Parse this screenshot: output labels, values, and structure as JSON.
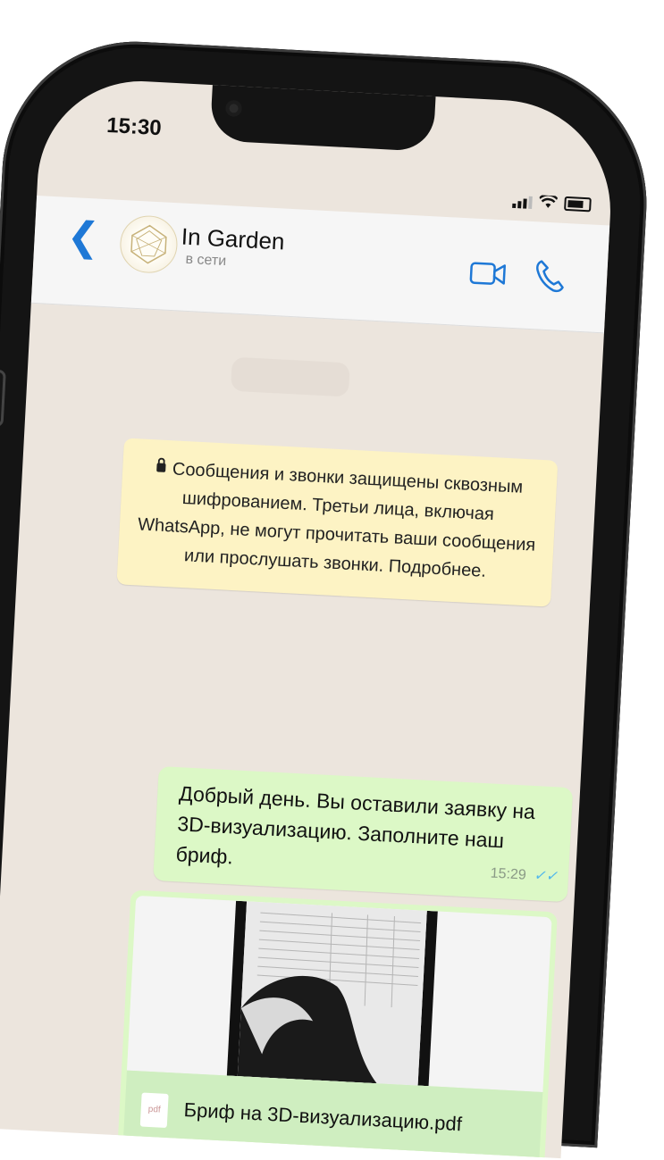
{
  "status_bar": {
    "time": "15:30"
  },
  "header": {
    "contact_name": "In Garden",
    "contact_status": "в сети",
    "back_icon": "chevron-left-icon",
    "video_icon": "video-call-icon",
    "call_icon": "phone-icon",
    "accent_color": "#1e78d6"
  },
  "notice": {
    "text": "Сообщения и звонки защищены сквозным шифрованием. Третьи лица, включая WhatsApp, не могут прочитать ваши сообщения или прослушать звонки. Подробнее."
  },
  "messages": [
    {
      "text": "Добрый день. Вы оставили заявку на 3D-визуализацию. Заполните наш бриф.",
      "time": "15:29",
      "status": "read"
    }
  ],
  "document": {
    "icon_label": "pdf",
    "filename": "Бриф на 3D-визуализацию.pdf"
  }
}
